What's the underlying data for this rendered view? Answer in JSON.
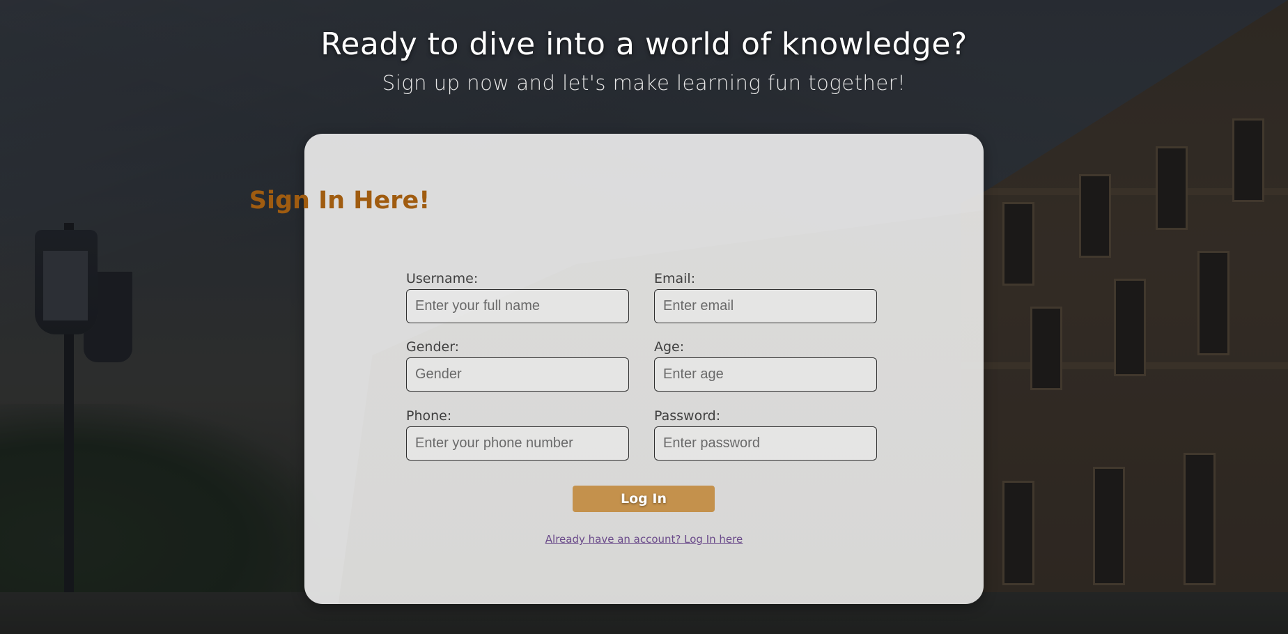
{
  "hero": {
    "title": "Ready to dive into a world of knowledge?",
    "subtitle": "Sign up now and let's make learning fun together!"
  },
  "form": {
    "title": "Sign In Here!",
    "fields": {
      "username": {
        "label": "Username:",
        "placeholder": "Enter your full name"
      },
      "email": {
        "label": "Email:",
        "placeholder": "Enter email"
      },
      "gender": {
        "label": "Gender:",
        "placeholder": "Gender"
      },
      "age": {
        "label": "Age:",
        "placeholder": "Enter age"
      },
      "phone": {
        "label": "Phone:",
        "placeholder": "Enter your phone number"
      },
      "password": {
        "label": "Password:",
        "placeholder": "Enter password"
      }
    },
    "submit_label": "Log In",
    "login_link_text": "Already have an account? Log In here"
  },
  "colors": {
    "title_accent": "#a05c10",
    "button": "#c4914c",
    "link": "#6a4a8a"
  }
}
